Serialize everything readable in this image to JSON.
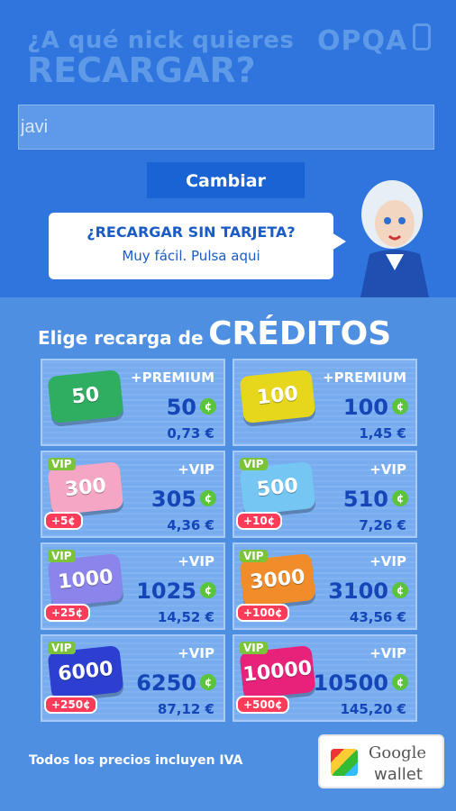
{
  "header": {
    "question_line1": "¿A qué nick quieres",
    "question_line2": "RECARGAR?",
    "brand": "OPQA"
  },
  "nick_input": {
    "value": "javi"
  },
  "change_button": {
    "label": "Cambiar"
  },
  "promo_bubble": {
    "title": "¿RECARGAR SIN TARJETA?",
    "subtitle": "Muy fácil. Pulsa aqui"
  },
  "credits_section": {
    "heading_small": "Elige recarga de",
    "heading_big": "CRÉDITOS"
  },
  "packs": [
    {
      "pack_label": "50",
      "tag": "+PREMIUM",
      "credits": "50",
      "coin": "¢",
      "price": "0,73 €",
      "color": "#2fae62"
    },
    {
      "pack_label": "100",
      "tag": "+PREMIUM",
      "credits": "100",
      "coin": "¢",
      "price": "1,45 €",
      "color": "#e6d71c"
    },
    {
      "pack_label": "300",
      "tag": "+VIP",
      "credits": "305",
      "coin": "¢",
      "price": "4,36 €",
      "color": "#f4a6c4",
      "vip": "VIP",
      "bonus": "+5¢"
    },
    {
      "pack_label": "500",
      "tag": "+VIP",
      "credits": "510",
      "coin": "¢",
      "price": "7,26 €",
      "color": "#76c6f4",
      "vip": "VIP",
      "bonus": "+10¢"
    },
    {
      "pack_label": "1000",
      "tag": "+VIP",
      "credits": "1025",
      "coin": "¢",
      "price": "14,52 €",
      "color": "#8b84ea",
      "vip": "VIP",
      "bonus": "+25¢"
    },
    {
      "pack_label": "3000",
      "tag": "+VIP",
      "credits": "3100",
      "coin": "¢",
      "price": "43,56 €",
      "color": "#f08c2a",
      "vip": "VIP",
      "bonus": "+100¢"
    },
    {
      "pack_label": "6000",
      "tag": "+VIP",
      "credits": "6250",
      "coin": "¢",
      "price": "87,12 €",
      "color": "#2c3fd0",
      "vip": "VIP",
      "bonus": "+250¢"
    },
    {
      "pack_label": "10000",
      "tag": "+VIP",
      "credits": "10500",
      "coin": "¢",
      "price": "145,20 €",
      "color": "#e8217a",
      "vip": "VIP",
      "bonus": "+500¢"
    }
  ],
  "footer": {
    "vat_note": "Todos los precios incluyen IVA",
    "wallet_line1": "Google",
    "wallet_line2": "wallet"
  }
}
